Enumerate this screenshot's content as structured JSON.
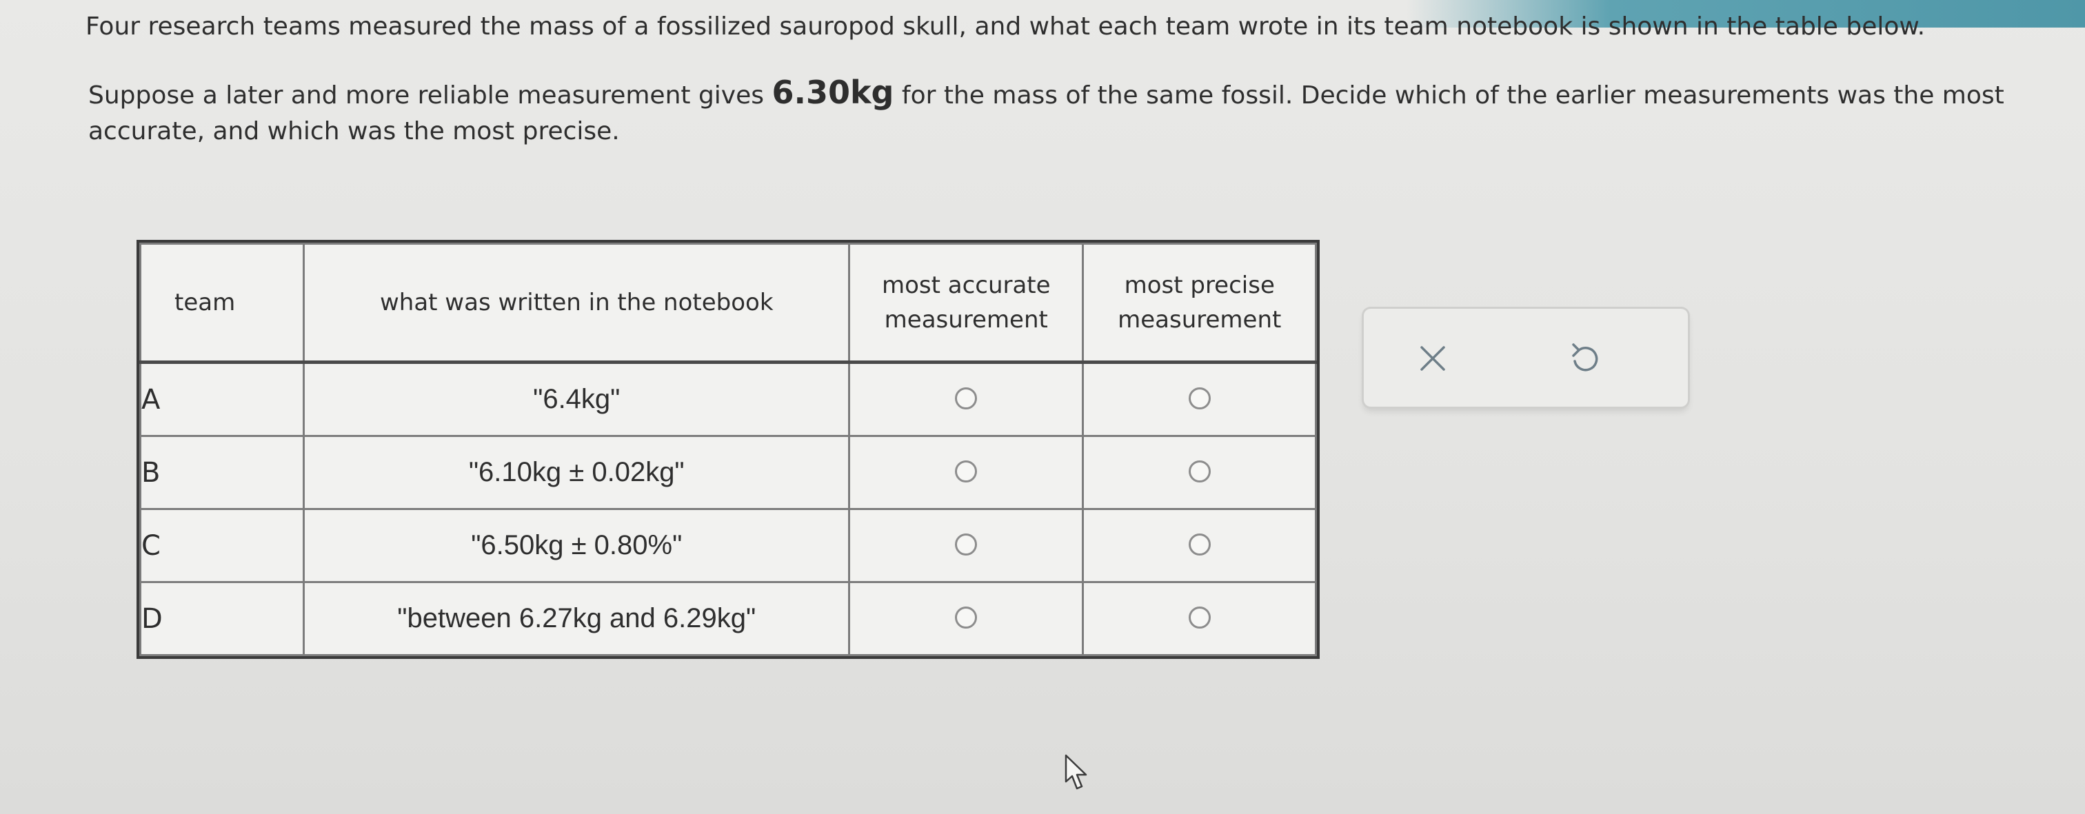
{
  "intro_text": "Four research teams measured the mass of a fossilized sauropod skull, and what each team wrote in its team notebook is shown in the table below.",
  "question": {
    "before": "Suppose a later and more reliable measurement gives ",
    "mass": "6.30kg",
    "after": " for the mass of the same fossil. Decide which of the earlier measurements was the most accurate, and which was the most precise."
  },
  "table": {
    "headers": {
      "team": "team",
      "written": "what was written in the notebook",
      "accurate": "most accurate measurement",
      "precise": "most precise measurement"
    },
    "rows": [
      {
        "team": "A",
        "written": "\"6.4kg\""
      },
      {
        "team": "B",
        "written": "\"6.10kg ± 0.02kg\""
      },
      {
        "team": "C",
        "written": "\"6.50kg ± 0.80%\""
      },
      {
        "team": "D",
        "written": "\"between 6.27kg and 6.29kg\""
      }
    ]
  },
  "actions": {
    "clear_icon": "x-icon",
    "undo_icon": "undo-icon"
  },
  "colors": {
    "accent_strip": "#4f97a8",
    "radio_border": "#8d8d8d",
    "table_border": "#4a4a4a"
  }
}
